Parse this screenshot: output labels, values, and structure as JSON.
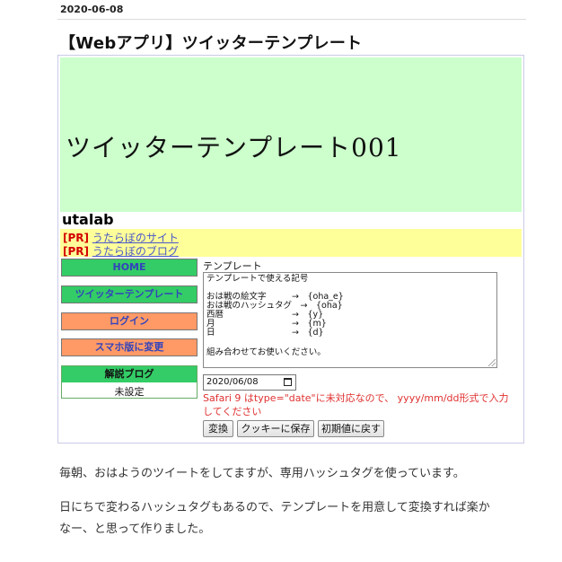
{
  "post": {
    "date": "2020-06-08",
    "title": "【Webアプリ】ツイッターテンプレート"
  },
  "app": {
    "banner_title": "ツイッターテンプレート001",
    "site_name": "utalab",
    "pr_links": [
      {
        "tag": "[PR]",
        "text": "うたらぼのサイト"
      },
      {
        "tag": "[PR]",
        "text": "うたらぼのブログ"
      }
    ],
    "nav": {
      "home": "HOME",
      "twitter_template": "ツイッターテンプレート",
      "login": "ログイン",
      "mobile": "スマホ版に変更"
    },
    "blog_box": {
      "heading": "解説ブログ",
      "value": "未設定"
    },
    "template_label": "テンプレート",
    "template_lines": [
      "テンプレートで使える記号",
      "",
      "おは戦の絵文字　　　→　{oha_e}",
      "おは戦のハッシュタグ　→　{oha}",
      "西暦　　　　　　　　→　{y}",
      "月　　　　　　　　　→　{m}",
      "日　　　　　　　　　→　{d}",
      "",
      "組み合わせてお使いください。"
    ],
    "date_value": "2020/06/08",
    "warning": "Safari 9 はtype=\"date\"に未対応なので、 yyyy/mm/dd形式で入力してください",
    "buttons": {
      "convert": "変換",
      "save_cookie": "クッキーに保存",
      "reset": "初期値に戻す"
    }
  },
  "body": {
    "para1": "毎朝、おはようのツイートをしてますが、専用ハッシュタグを使っています。",
    "para2_line1": "日にちで変わるハッシュタグもあるので、テンプレートを用意して変換すれば楽か",
    "para2_line2": "なー、と思って作りました。"
  },
  "colors": {
    "banner_bg": "#ccffcc",
    "pr_bg": "#ffff99",
    "nav_green": "#33cc66",
    "nav_orange": "#ff9966",
    "link": "#4a58c7",
    "warning": "#e03030",
    "pr_tag": "#d40000"
  }
}
